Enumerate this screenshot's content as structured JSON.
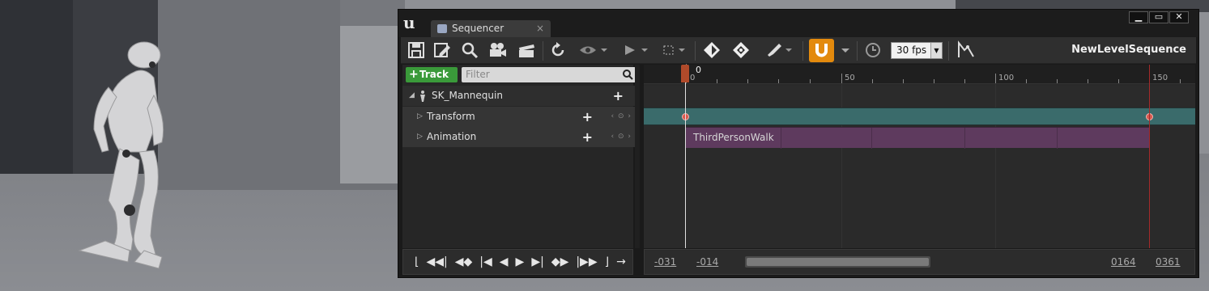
{
  "tab": {
    "label": "Sequencer",
    "close": "×"
  },
  "window_buttons": {
    "minimize": "▁",
    "maximize": "▭",
    "close": "✕"
  },
  "toolbar": {
    "fps": "30 fps",
    "sequence_name": "NewLevelSequence",
    "icons": [
      "save-icon",
      "save-as-icon",
      "find-icon",
      "camera-icon",
      "clapper-icon",
      "refresh-icon",
      "eye-icon",
      "play-icon",
      "selection-icon",
      "key-icon",
      "key-all-icon",
      "brush-icon",
      "magnet-icon",
      "clock-icon",
      "curve-icon"
    ]
  },
  "outliner": {
    "track_button": "Track",
    "filter_placeholder": "Filter",
    "rows": [
      {
        "label": "SK_Mannequin"
      },
      {
        "label": "Transform"
      },
      {
        "label": "Animation"
      }
    ],
    "key_nav": "‹ ⊙ ›"
  },
  "timeline": {
    "playhead_frame": "0",
    "ruler_labels": [
      "0",
      "50",
      "100",
      "150"
    ],
    "animation_section": "ThirdPersonWalk"
  },
  "transport": {
    "labels": [
      "⌊",
      "◀◀|",
      "◀◆",
      "|◀",
      "◀",
      "▶",
      "▶|",
      "◆▶",
      "|▶▶",
      "⌋",
      "→"
    ]
  },
  "range": {
    "view_start": "-031",
    "work_start": "-014",
    "work_end": "0164",
    "view_end": "0361"
  }
}
